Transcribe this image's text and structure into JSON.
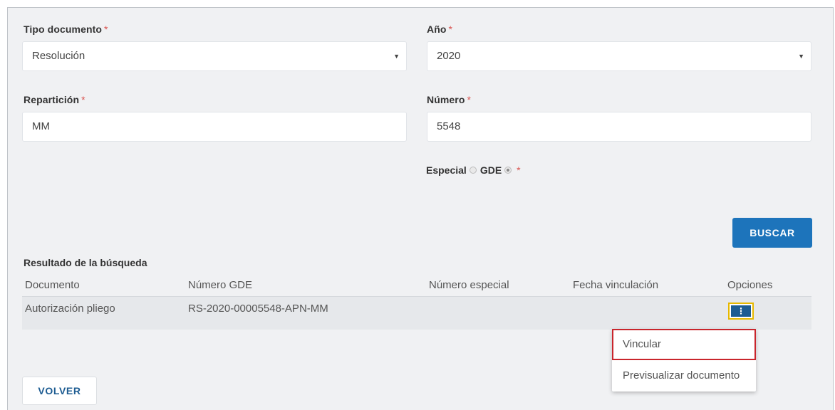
{
  "form": {
    "tipo_documento": {
      "label": "Tipo documento",
      "required": "*",
      "value": "Resolución",
      "caret": "▼"
    },
    "anio": {
      "label": "Año",
      "required": "*",
      "value": "2020",
      "caret": "▼"
    },
    "reparticion": {
      "label": "Repartición",
      "required": "*",
      "value": "MM"
    },
    "numero": {
      "label": "Número",
      "required": "*",
      "value": "5548"
    },
    "tipo_numero": {
      "options": [
        {
          "label": "Especial",
          "checked": false
        },
        {
          "label": "GDE",
          "checked": true
        }
      ],
      "required": "*"
    },
    "buscar_label": "BUSCAR"
  },
  "results": {
    "title": "Resultado de la búsqueda",
    "columns": [
      "Documento",
      "Número GDE",
      "Número especial",
      "Fecha vinculación",
      "Opciones"
    ],
    "rows": [
      {
        "documento": "Autorización pliego",
        "numero_gde": "RS-2020-00005548-APN-MM",
        "numero_especial": "",
        "fecha_vinculacion": "",
        "options_icon": "⋮"
      }
    ]
  },
  "options_menu": {
    "items": [
      "Vincular",
      "Previsualizar documento"
    ]
  },
  "volver_label": "VOLVER",
  "colors": {
    "primary": "#1d74bb",
    "required": "#d9534f",
    "highlight": "#c9252c",
    "focus": "#e6b800"
  }
}
